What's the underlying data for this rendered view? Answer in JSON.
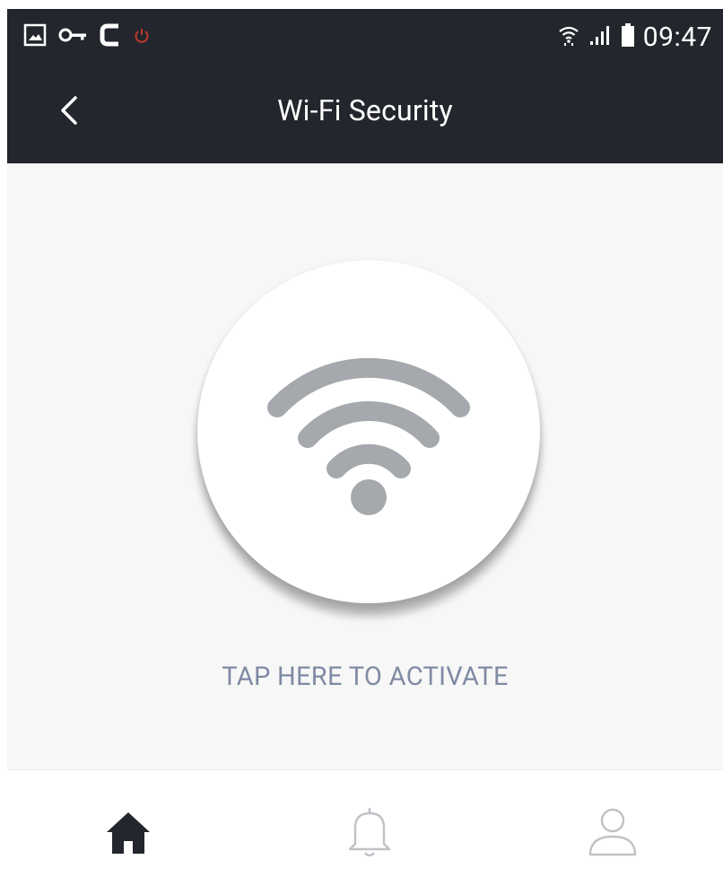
{
  "status_bar": {
    "time": "09:47",
    "left_icons": [
      "gallery-icon",
      "vpn-key-icon",
      "ccleaner-icon",
      "power-icon"
    ],
    "right_icons": [
      "wifi-signal-icon",
      "cellular-signal-icon",
      "battery-icon"
    ]
  },
  "app_bar": {
    "title": "Wi-Fi Security",
    "back_icon": "chevron-left-icon"
  },
  "main": {
    "activate_label": "TAP HERE TO ACTIVATE",
    "wifi_icon": "wifi-icon"
  },
  "bottom_nav": {
    "items": [
      {
        "icon": "home-icon",
        "active": true
      },
      {
        "icon": "bell-icon",
        "active": false
      },
      {
        "icon": "user-icon",
        "active": false
      }
    ]
  },
  "colors": {
    "header_bg": "#23262d",
    "content_bg": "#f7f7f7",
    "accent_text": "#7f8aa3",
    "wifi_glyph": "#a5a8ac",
    "nav_active": "#23262d",
    "nav_inactive": "#bfc2c6"
  }
}
